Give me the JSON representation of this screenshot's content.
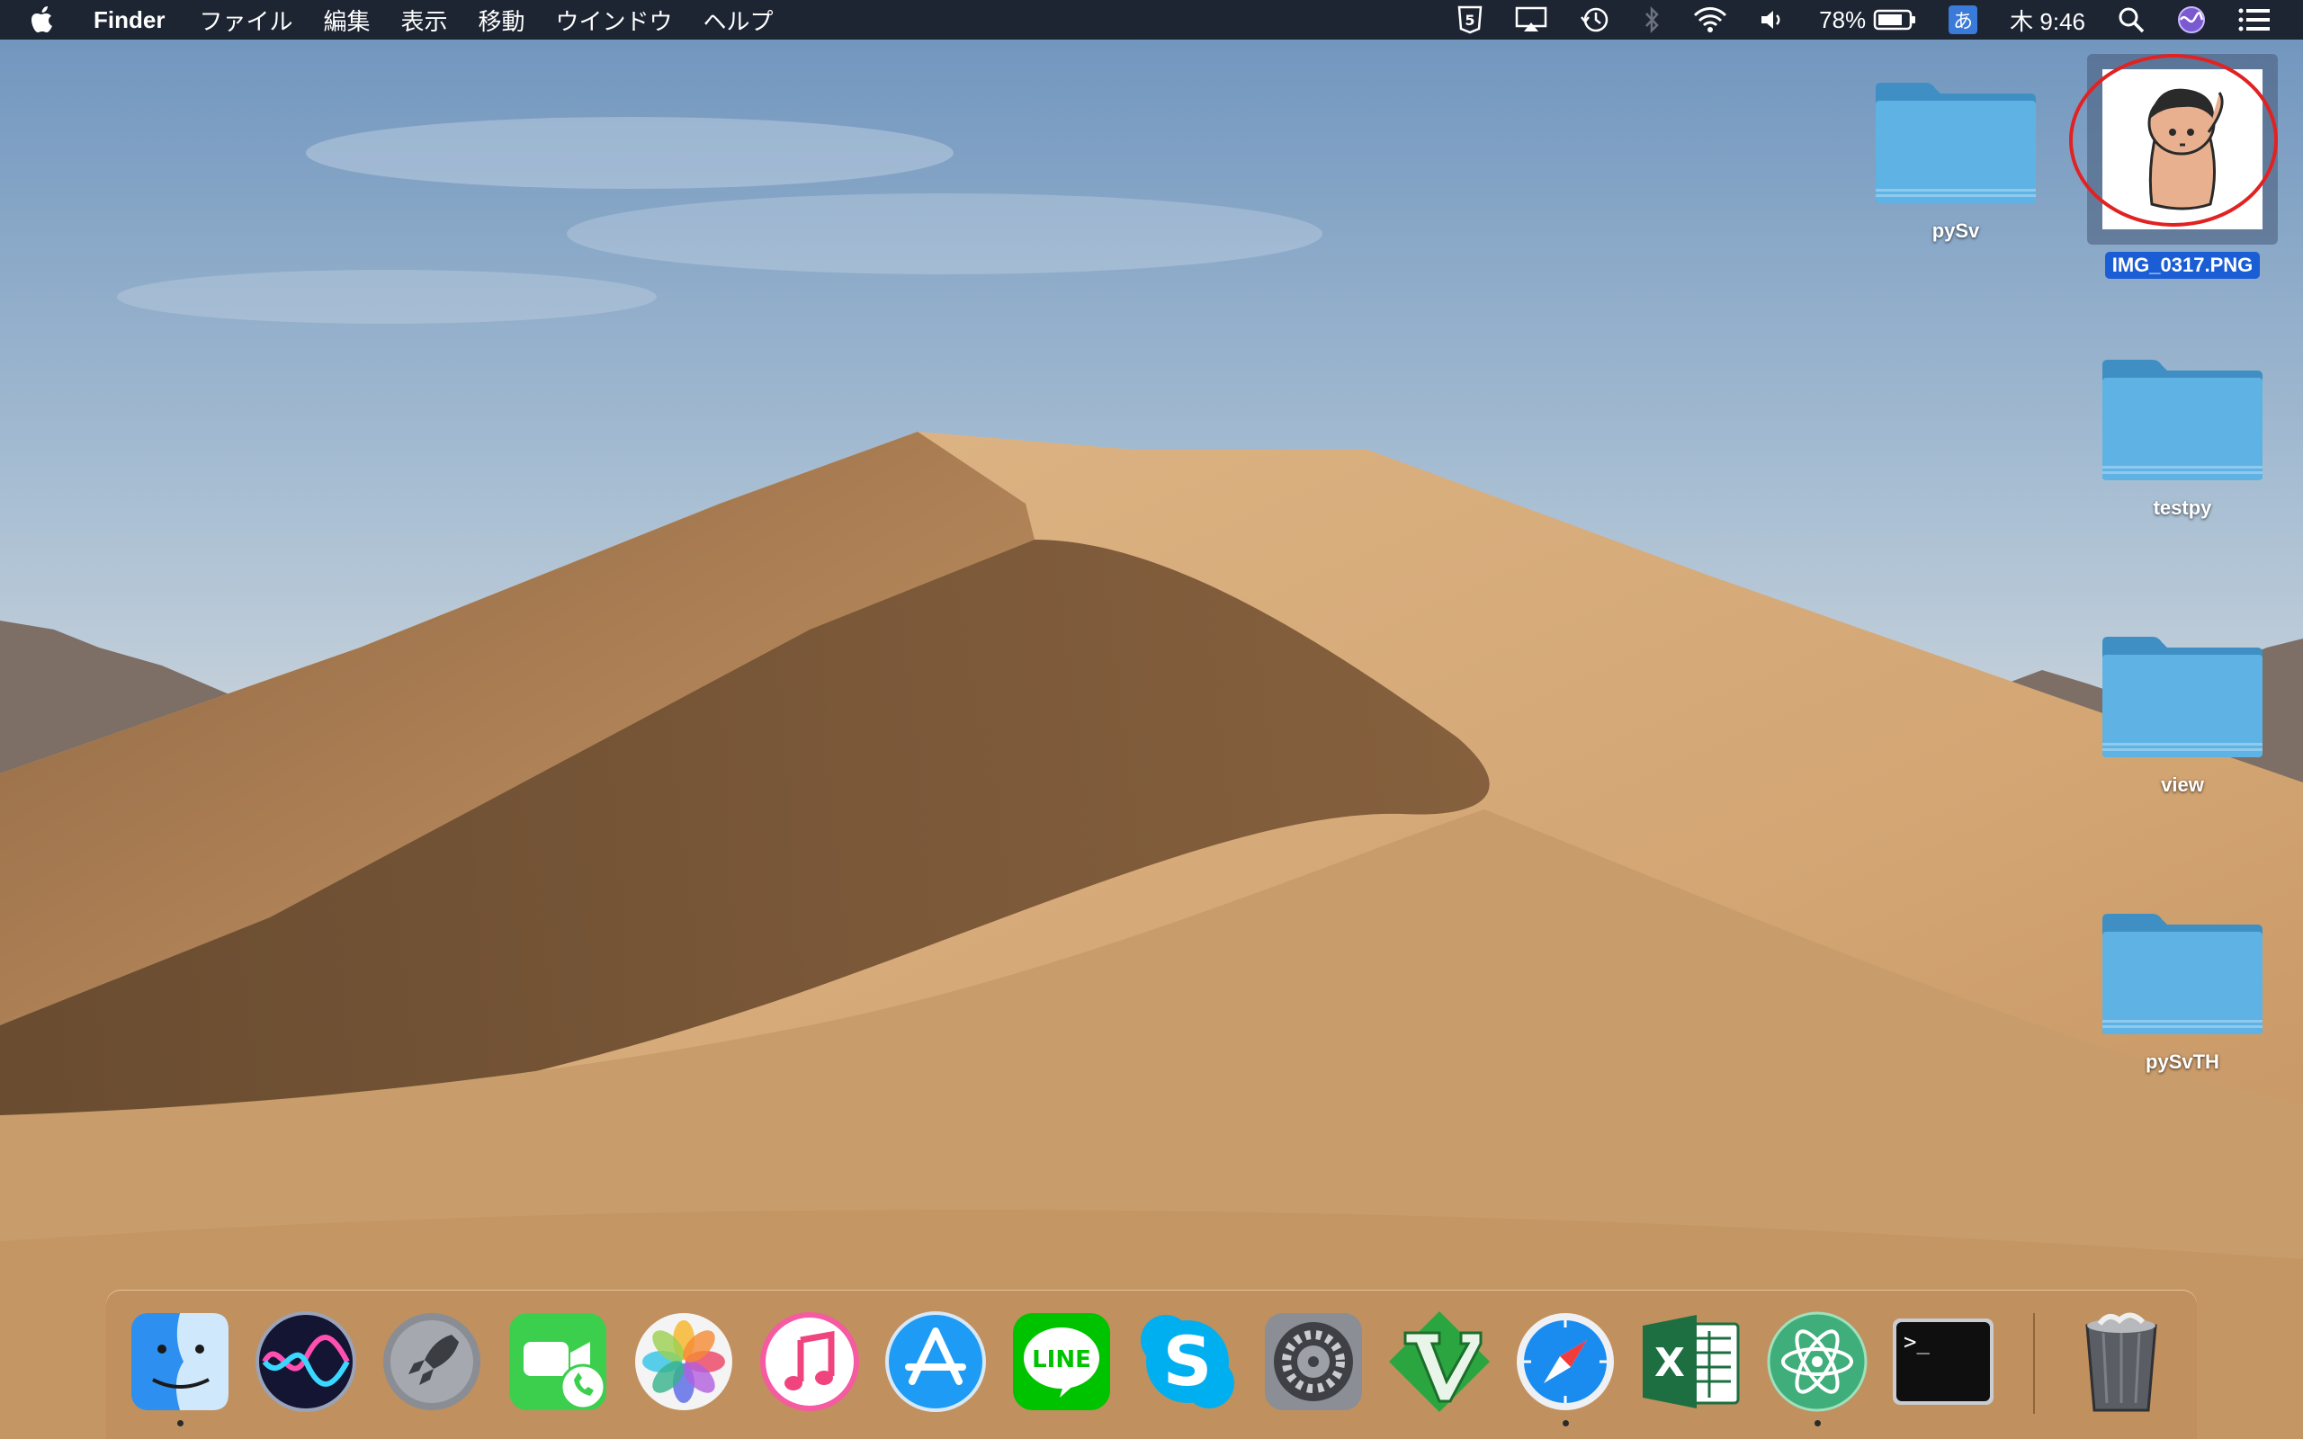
{
  "menubar": {
    "apple_icon": "apple-icon",
    "app_name": "Finder",
    "menus": [
      "ファイル",
      "編集",
      "表示",
      "移動",
      "ウインドウ",
      "ヘルプ"
    ],
    "status": {
      "battery_percent": "78%",
      "input_method": "あ",
      "clock": "木 9:46",
      "icons": [
        "html5-icon",
        "airplay-icon",
        "time-machine-icon",
        "bluetooth-icon",
        "wifi-icon",
        "volume-icon",
        "battery-icon",
        "spotlight-search-icon",
        "siri-icon",
        "notification-center-icon"
      ]
    }
  },
  "desktop": {
    "icons": [
      {
        "label": "pySv",
        "type": "folder"
      },
      {
        "label": "IMG_0317.PNG",
        "type": "image",
        "selected": true
      },
      {
        "label": "testpy",
        "type": "folder"
      },
      {
        "label": "view",
        "type": "folder"
      },
      {
        "label": "pySvTH",
        "type": "folder"
      }
    ],
    "annotation": "red-circle-highlight"
  },
  "dock": {
    "apps": [
      "finder-icon",
      "siri-icon",
      "launchpad-icon",
      "facetime-icon",
      "photos-icon",
      "itunes-icon",
      "app-store-icon",
      "line-icon",
      "skype-icon",
      "system-preferences-icon",
      "vim-icon",
      "safari-icon",
      "excel-icon",
      "atom-icon",
      "terminal-icon"
    ],
    "trash": "trash-icon",
    "running_indicators": [
      "finder-icon",
      "safari-icon",
      "atom-icon"
    ]
  },
  "colors": {
    "menubar_bg": "#1d2432",
    "folder_blue": "#5fb3e4",
    "selection_blue": "#1b5dd4",
    "annotation_red": "#e22222",
    "sky_top": "#6d93bd",
    "sand": "#c79a68"
  }
}
